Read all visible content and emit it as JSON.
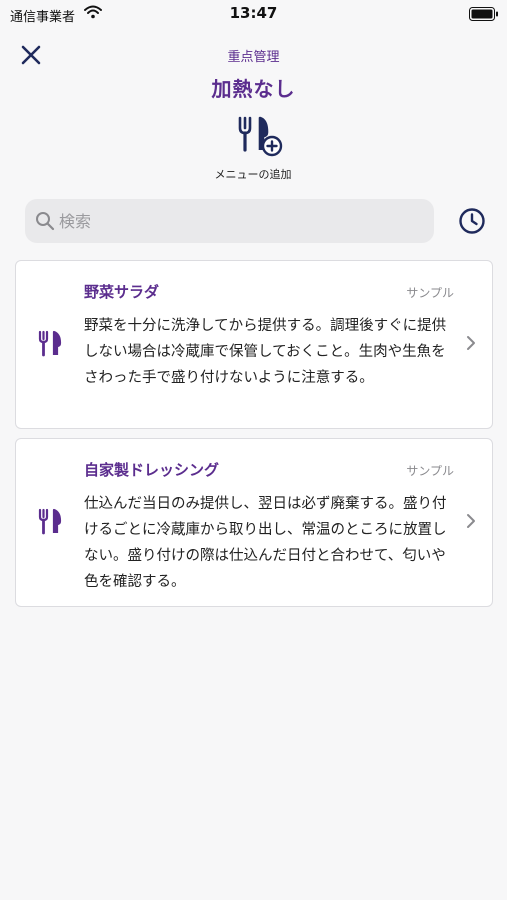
{
  "status_bar": {
    "carrier": "通信事業者",
    "time": "13:47"
  },
  "header": {
    "subtitle": "重点管理",
    "title": "加熱なし"
  },
  "add_menu": {
    "label": "メニューの追加"
  },
  "search": {
    "placeholder": "検索",
    "value": ""
  },
  "colors": {
    "accent": "#5b2d8e",
    "navy": "#1f2a5c",
    "background": "#f7f7f8"
  },
  "menu_items": [
    {
      "title": "野菜サラダ",
      "badge": "サンプル",
      "description": "野菜を十分に洗浄してから提供する。調理後すぐに提供しない場合は冷蔵庫で保管しておくこと。生肉や生魚をさわった手で盛り付けないように注意する。",
      "icon": "fork-knife-icon"
    },
    {
      "title": "自家製ドレッシング",
      "badge": "サンプル",
      "description": "仕込んだ当日のみ提供し、翌日は必ず廃棄する。盛り付けるごとに冷蔵庫から取り出し、常温のところに放置しない。盛り付けの際は仕込んだ日付と合わせて、匂いや色を確認する。",
      "icon": "fork-knife-icon"
    }
  ]
}
